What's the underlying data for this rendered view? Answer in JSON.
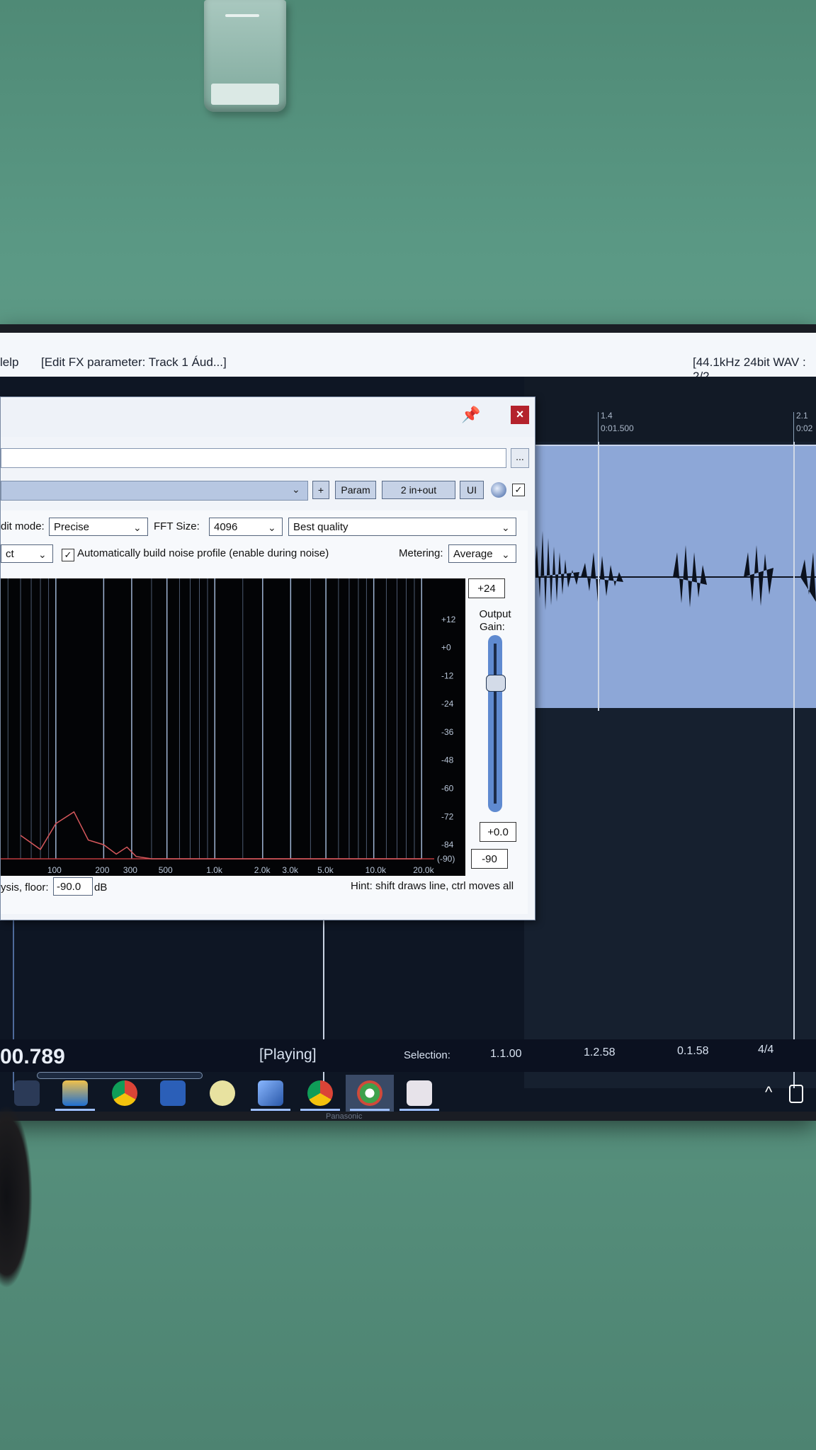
{
  "window": {
    "menu_help": "lelp",
    "title_undo": "[Edit FX parameter: Track 1 Áud...]",
    "project_info": "[44.1kHz 24bit WAV : 2/2"
  },
  "ruler": {
    "marker_bar": "1.4",
    "marker_time": "0:01.500",
    "marker2_bar": "2.1",
    "marker2_time": "0:02"
  },
  "fx_window": {
    "more_label": "...",
    "add_label": "+",
    "param_label": "Param",
    "io_label": "2 in+out",
    "ui_label": "UI",
    "close_label": "×",
    "edit_mode_label": "dit mode:",
    "edit_mode_value": "Precise",
    "fft_label": "FFT Size:",
    "fft_value": "4096",
    "quality_value": "Best quality",
    "mode_value": "ct",
    "auto_profile_label": "Automatically build noise profile (enable during noise)",
    "metering_label": "Metering:",
    "metering_value": "Average",
    "output_gain_label_1": "Output",
    "output_gain_label_2": "Gain:",
    "gain_max": "+24",
    "gain_value": "+0.0",
    "gain_min": "-90",
    "floor_label": "ysis, floor:",
    "floor_value": "-90.0",
    "floor_unit": "dB",
    "hint": "Hint: shift draws line, ctrl moves all"
  },
  "chart_data": {
    "type": "line",
    "x_ticks": [
      "100",
      "200",
      "300",
      "500",
      "1.0k",
      "2.0k",
      "3.0k",
      "5.0k",
      "10.0k",
      "20.0k"
    ],
    "y_ticks": [
      "+12",
      "+0",
      "-12",
      "-24",
      "-36",
      "-48",
      "-60",
      "-72",
      "-84",
      "(-90)"
    ],
    "x_scale": "log",
    "ylim": [
      -90,
      24
    ],
    "series": [
      {
        "x": [
          60,
          80,
          100,
          130,
          160,
          200,
          240,
          280,
          320,
          400,
          500,
          1000,
          20000
        ],
        "y": [
          -80,
          -86,
          -75,
          -70,
          -82,
          -84,
          -88,
          -85,
          -89,
          -90,
          -90,
          -90,
          -90
        ]
      }
    ],
    "series_color": "#d6585c",
    "grid": true
  },
  "transport": {
    "time": "00.789",
    "state": "[Playing]",
    "selection_label": "Selection:",
    "sel_start": "1.1.00",
    "sel_end": "1.2.58",
    "sel_len": "0.1.58",
    "time_sig": "4/4"
  },
  "taskbar": {
    "icons": [
      "start-icon",
      "file-explorer-icon",
      "chrome-icon",
      "word-icon",
      "emoji-app-icon",
      "notes-app-icon",
      "chrome-icon",
      "reaper-icon",
      "publisher-icon"
    ]
  },
  "monitor_brand": "Panasonic"
}
